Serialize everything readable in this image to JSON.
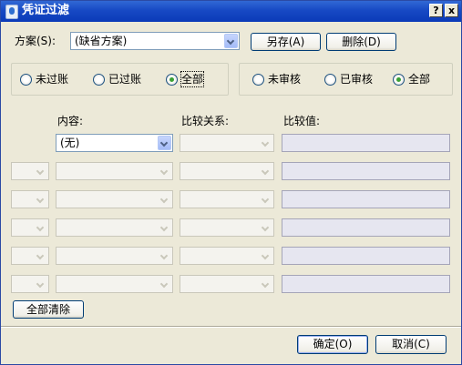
{
  "window": {
    "title": "凭证过滤",
    "help_button": "?",
    "close_button": "x"
  },
  "scheme": {
    "label": "方案(S):",
    "value": "(缺省方案)",
    "save_as": "另存(A)",
    "delete": "删除(D)"
  },
  "post_status": {
    "options": [
      "未过账",
      "已过账",
      "全部"
    ],
    "selected": "全部"
  },
  "audit_status": {
    "options": [
      "未审核",
      "已审核",
      "全部"
    ],
    "selected": "全部"
  },
  "conditions": {
    "headers": {
      "content": "内容:",
      "relation": "比较关系:",
      "value": "比较值:"
    },
    "first_row_content": "(无)"
  },
  "clear_all": "全部清除",
  "footer": {
    "ok": "确定(O)",
    "cancel": "取消(C)"
  }
}
